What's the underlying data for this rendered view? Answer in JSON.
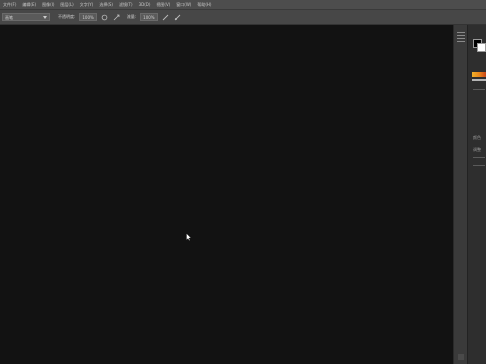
{
  "menubar": {
    "items": [
      "文件(F)",
      "编辑(E)",
      "图像(I)",
      "图层(L)",
      "文字(Y)",
      "选择(S)",
      "滤镜(T)",
      "3D(D)",
      "视图(V)",
      "窗口(W)",
      "帮助(H)"
    ]
  },
  "options": {
    "brush_preset": "画笔",
    "mode_label": "不透明度:",
    "opacity_value": "100%",
    "flow_label": "流量:",
    "flow_value": "100%",
    "icons": [
      "pressure-icon",
      "airbrush-icon",
      "pressure-size-icon"
    ]
  },
  "colors": {
    "foreground": "#000000",
    "background": "#ffffff"
  },
  "panel": {
    "labels": [
      "颜色",
      "调整"
    ]
  }
}
